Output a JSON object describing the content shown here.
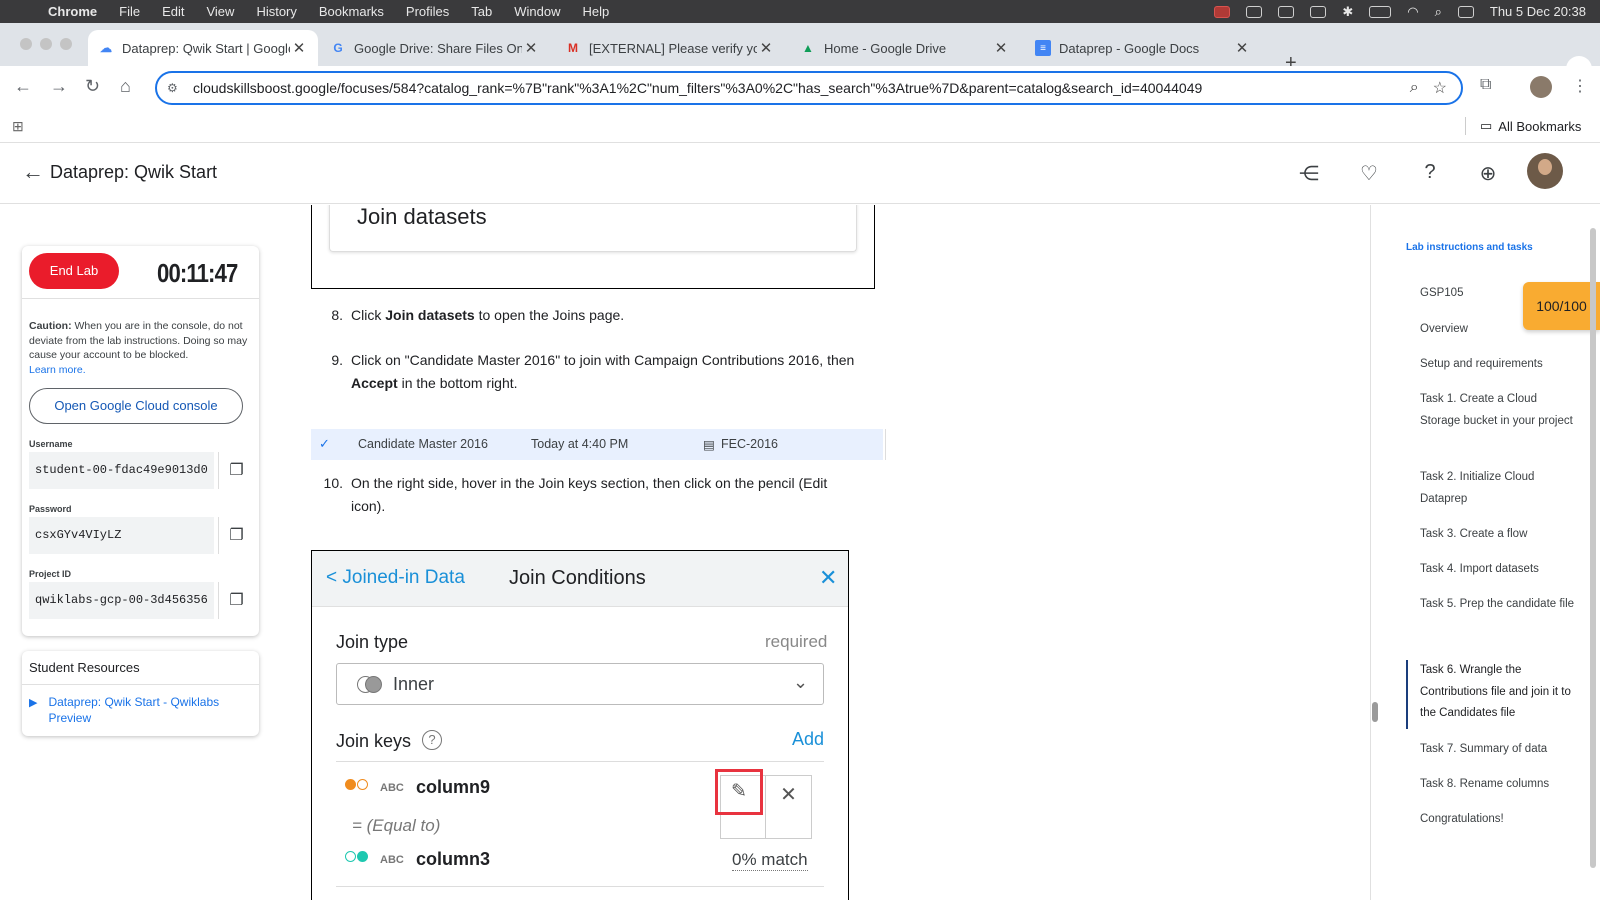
{
  "menubar": {
    "app": "Chrome",
    "items": [
      "File",
      "Edit",
      "View",
      "History",
      "Bookmarks",
      "Profiles",
      "Tab",
      "Window",
      "Help"
    ],
    "datetime": "Thu 5 Dec  20:38"
  },
  "tabs": [
    {
      "title": "Dataprep: Qwik Start | Google",
      "icon": "google-cloud-icon"
    },
    {
      "title": "Google Drive: Share Files Onl",
      "icon": "google-icon"
    },
    {
      "title": "[EXTERNAL] Please verify yo",
      "icon": "gmail-icon"
    },
    {
      "title": "Home - Google Drive",
      "icon": "google-drive-icon"
    },
    {
      "title": "Dataprep - Google Docs",
      "icon": "google-docs-icon"
    }
  ],
  "omnibox": {
    "url": "cloudskillsboost.google/focuses/584?catalog_rank=%7B\"rank\"%3A1%2C\"num_filters\"%3A0%2C\"has_search\"%3Atrue%7D&parent=catalog&search_id=40044049"
  },
  "bookmarks": {
    "all_label": "All Bookmarks"
  },
  "page": {
    "title": "Dataprep: Qwik Start"
  },
  "lab": {
    "end_label": "End Lab",
    "timer": "00:11:47",
    "caution_bold": "Caution:",
    "caution_text": " When you are in the console, do not deviate from the lab instructions. Doing so may cause your account to be blocked.",
    "learn_more": "Learn more.",
    "console_button": "Open Google Cloud console",
    "username_label": "Username",
    "username": "student-00-fdac49e9013d0",
    "password_label": "Password",
    "password": "csxGYv4VIyLZ",
    "project_label": "Project ID",
    "project": "qwiklabs-gcp-00-3d456356"
  },
  "resources": {
    "heading": "Student Resources",
    "link": "Dataprep: Qwik Start - Qwiklabs Preview"
  },
  "content": {
    "join_datasets_image": "Join datasets",
    "step8_num": "8.",
    "step8_pre": "Click ",
    "step8_bold": "Join datasets",
    "step8_post": " to open the Joins page.",
    "step9_num": "9.",
    "step9_line1": "Click on \"Candidate Master 2016\" to join with Campaign Contributions 2016, then",
    "step9_bold": "Accept",
    "step9_post": " in the bottom right.",
    "dataset_row": {
      "name": "Candidate Master 2016",
      "time": "Today at 4:40 PM",
      "source": "FEC-2016"
    },
    "step10_num": "10.",
    "step10_line1": "On the right side, hover in the Join keys section, then click on the pencil (Edit",
    "step10_line2": "icon)."
  },
  "join_panel": {
    "back": "< Joined-in Data",
    "title": "Join Conditions",
    "join_type_label": "Join type",
    "required": "required",
    "join_type_value": "Inner",
    "join_keys_label": "Join keys",
    "add": "Add",
    "abc": "ABC",
    "key1": "column9",
    "equal": "= (Equal to)",
    "key2": "column3",
    "match": "0% match"
  },
  "toc": {
    "heading": "Lab instructions and tasks",
    "score": "100/100",
    "items": [
      "GSP105",
      "Overview",
      "Setup and requirements",
      "Task 1. Create a Cloud Storage bucket in your project",
      "Task 2. Initialize Cloud Dataprep",
      "Task 3. Create a flow",
      "Task 4. Import datasets",
      "Task 5. Prep the candidate file",
      "Task 6. Wrangle the Contributions file and join it to the Candidates file",
      "Task 7. Summary of data",
      "Task 8. Rename columns",
      "Congratulations!"
    ],
    "active_index": 8
  },
  "colors": {
    "accent": "#1a73e8",
    "end_lab": "#ea1c2b",
    "score": "#f9ab31",
    "highlight": "#e8333f"
  }
}
